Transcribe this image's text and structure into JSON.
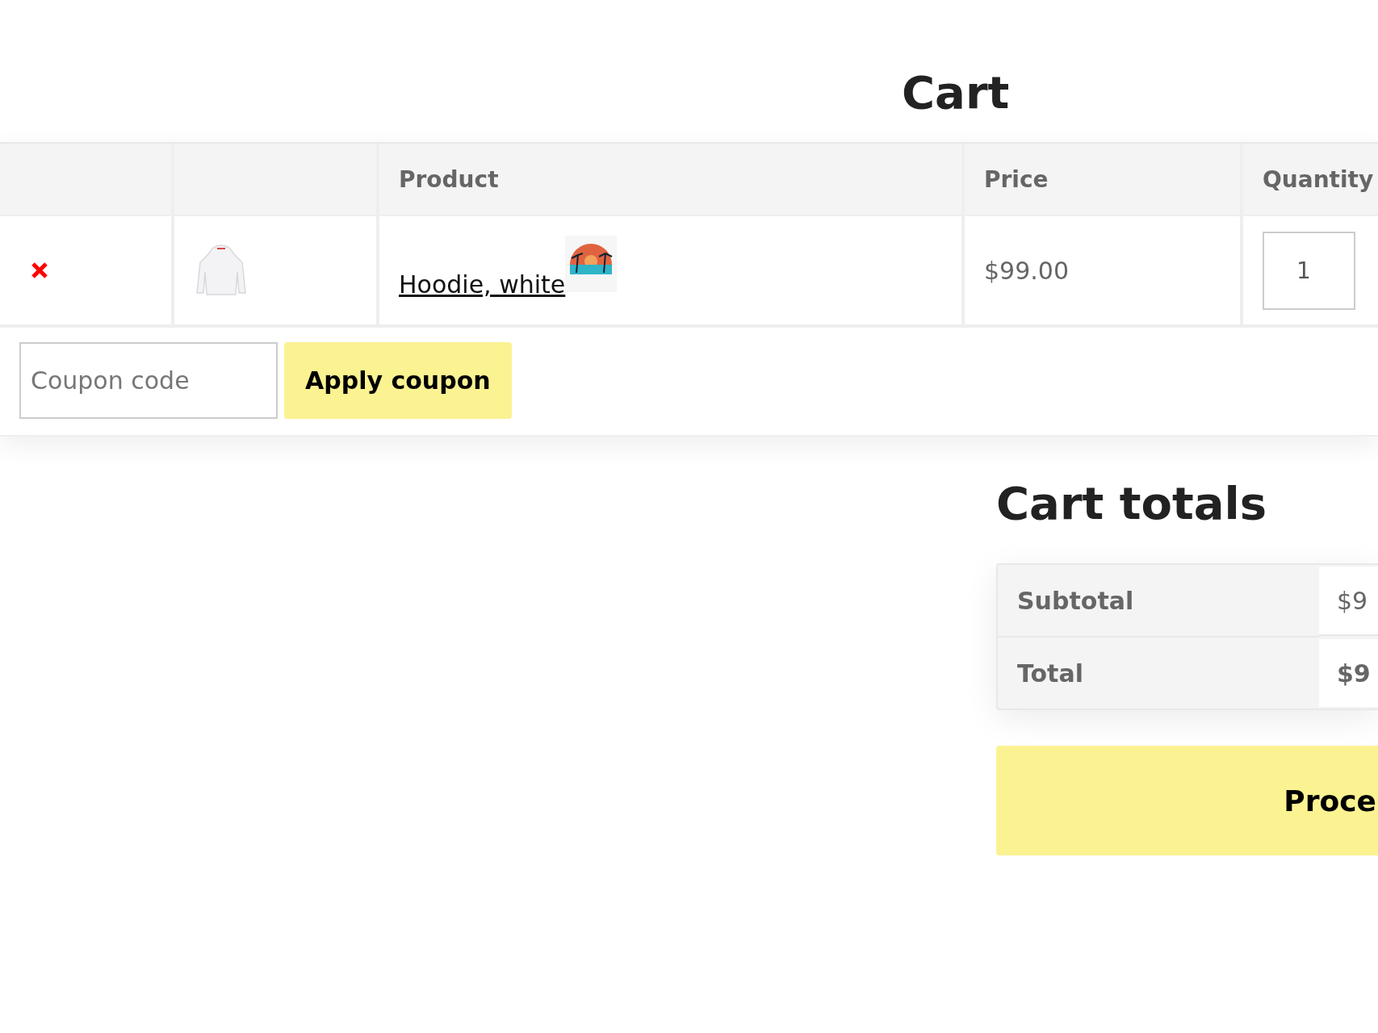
{
  "page_title": "Cart",
  "table": {
    "columns": [
      {
        "label": "Product"
      },
      {
        "label": "Price"
      },
      {
        "label": "Quantity"
      }
    ],
    "rows": [
      {
        "product": "Hoodie, white",
        "price": "$99.00",
        "quantity": "1"
      }
    ]
  },
  "coupon": {
    "placeholder": "Coupon code",
    "button": "Apply coupon"
  },
  "totals": {
    "title": "Cart totals",
    "rows": [
      {
        "label": "Subtotal",
        "value": "$9",
        "kind": "plain"
      },
      {
        "label": "Total",
        "value": "$9",
        "kind": "strong"
      }
    ]
  },
  "checkout_button": "Proce"
}
